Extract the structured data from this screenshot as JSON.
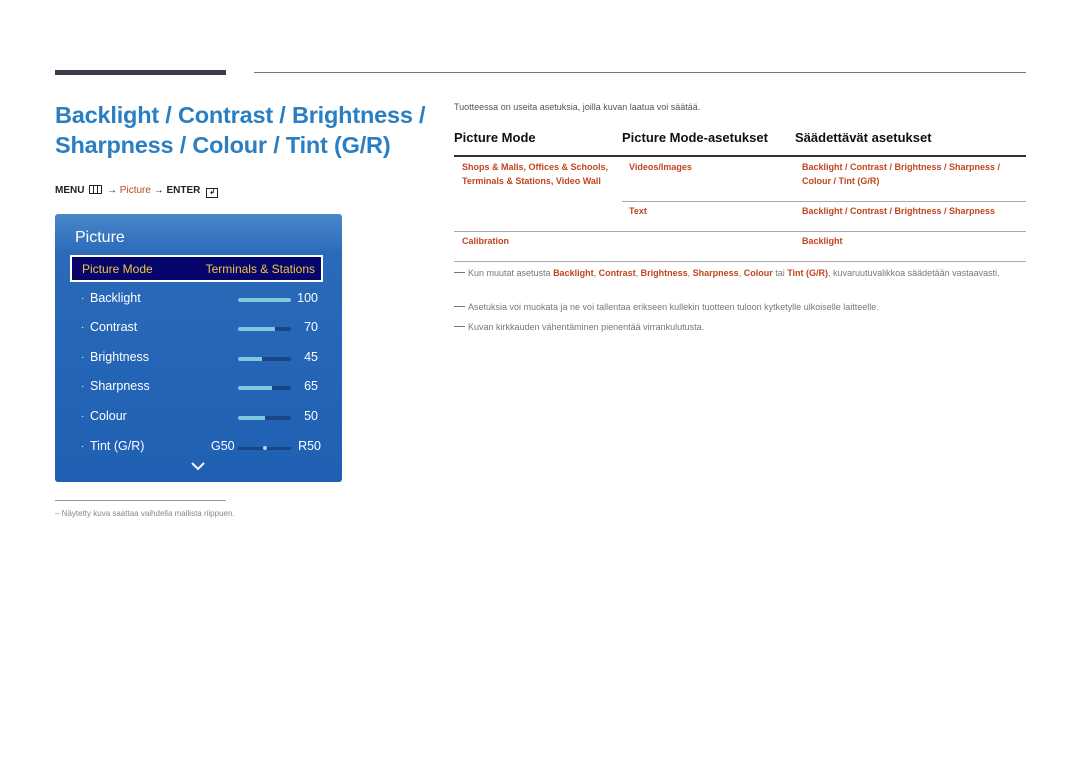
{
  "heading": {
    "title": "Backlight / Contrast / Brightness / Sharpness / Colour / Tint (G/R)"
  },
  "menu_path": {
    "menu": "MENU",
    "menu_icon": "menu-icon",
    "arrow1": "→",
    "picture": "Picture",
    "arrow2": "→",
    "enter": "ENTER",
    "enter_icon": "enter-icon"
  },
  "tv_menu": {
    "title": "Picture",
    "picture_mode": {
      "label": "Picture Mode",
      "value": "Terminals & Stations"
    },
    "settings": [
      {
        "label": "Backlight",
        "value": "100",
        "level": 100
      },
      {
        "label": "Contrast",
        "value": "70",
        "level": 70
      },
      {
        "label": "Brightness",
        "value": "45",
        "level": 45
      },
      {
        "label": "Sharpness",
        "value": "65",
        "level": 65
      },
      {
        "label": "Colour",
        "value": "50",
        "level": 50
      }
    ],
    "tint": {
      "label": "Tint (G/R)",
      "g_value": "G50",
      "r_value": "R50",
      "balance": 50
    },
    "more_icon": "chevron-down-icon",
    "bullet": "·"
  },
  "footnote": "–  Näytetty kuva saattaa vaihdella mallista riippuen.",
  "intro": "Tuotteessa on useita asetuksia, joilla kuvan laatua voi säätää.",
  "table": {
    "headers": [
      "Picture Mode",
      "Picture Mode-asetukset",
      "Säädettävät asetukset"
    ],
    "rows": [
      {
        "mode": "Shops & Malls, Offices & Schools, Terminals & Stations, Video Wall",
        "setting": "Videos/Images",
        "adjustable": "Backlight / Contrast / Brightness / Sharpness / Colour / Tint (G/R)"
      },
      {
        "mode": "",
        "setting": "Text",
        "adjustable": "Backlight / Contrast / Brightness / Sharpness"
      },
      {
        "mode": "Calibration",
        "setting": "",
        "adjustable": "Backlight"
      }
    ]
  },
  "notes": [
    {
      "prefix": "Kun muutat asetusta ",
      "terms": [
        "Backlight",
        "Contrast",
        "Brightness",
        "Sharpness",
        "Colour"
      ],
      "connector": " tai ",
      "last_term": "Tint (G/R)",
      "suffix": ", kuvaruutuvalikkoa säädetään vastaavasti."
    },
    {
      "text": "Asetuksia voi muokata ja ne voi tallentaa erikseen kullekin tuotteen tuloon kytketylle ulkoiselle laitteelle."
    },
    {
      "text": "Kuvan kirkkauden vähentäminen pienentää virrankulutusta."
    }
  ],
  "colors": {
    "title_blue": "#2a7ec3",
    "accent_orange": "#c1451e",
    "panel_blue": "#1f60b4",
    "highlight_navy": "#06056b",
    "highlight_text": "#f3c440"
  }
}
